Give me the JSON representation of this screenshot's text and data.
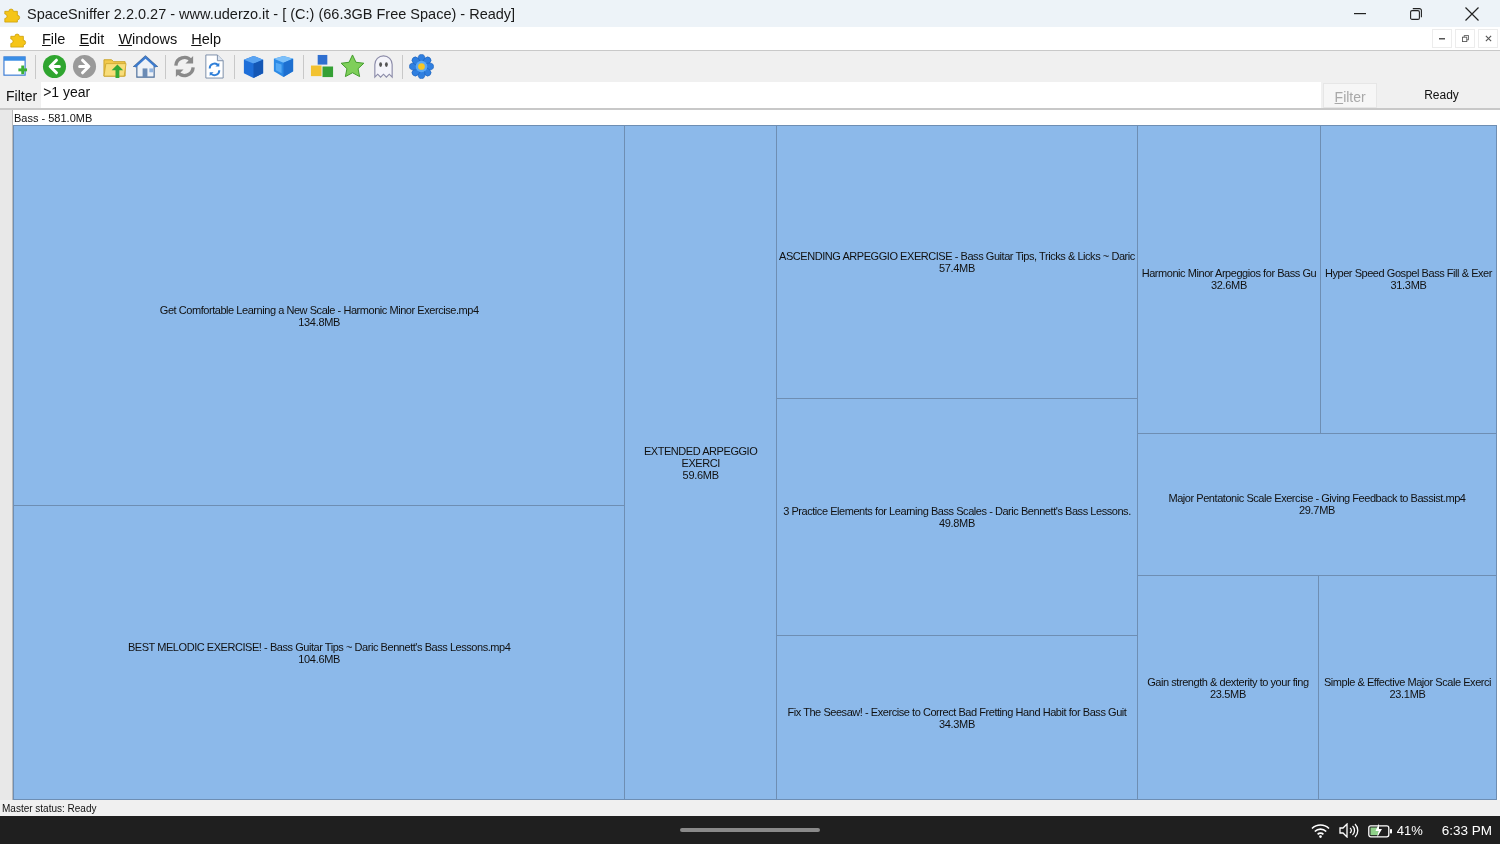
{
  "window": {
    "title": "SpaceSniffer 2.2.0.27 - www.uderzo.it - [ (C:) (66.3GB Free Space) - Ready]"
  },
  "menu": [
    "File",
    "Edit",
    "Windows",
    "Help"
  ],
  "toolbar": {
    "back_disabled": false,
    "forward_disabled": true
  },
  "filter": {
    "label": "Filter",
    "value": ">1 year",
    "button": {
      "label": "Filter",
      "disabled": true
    },
    "status": "Ready"
  },
  "treemap": {
    "header": "Bass - 581.0MB",
    "columns": [
      {
        "rows": [
          {
            "tiles": [
              {
                "name": "Get Comfortable Learning a New Scale - Harmonic Minor Exercise.mp4",
                "size": "134.8MB"
              }
            ]
          },
          {
            "tiles": [
              {
                "name": "BEST MELODIC EXERCISE! - Bass Guitar Tips ~ Daric Bennett's Bass Lessons.mp4",
                "size": "104.6MB"
              }
            ]
          }
        ]
      },
      {
        "rows": [
          {
            "tiles": [
              {
                "name": "EXTENDED ARPEGGIO EXERCI",
                "size": "59.6MB"
              }
            ]
          }
        ]
      },
      {
        "rows": [
          {
            "tiles": [
              {
                "name": "ASCENDING ARPEGGIO EXERCISE - Bass Guitar Tips, Tricks & Licks ~ Daric",
                "size": "57.4MB"
              }
            ]
          },
          {
            "tiles": [
              {
                "name": "3 Practice Elements for Learning Bass Scales - Daric Bennett's Bass Lessons.",
                "size": "49.8MB"
              }
            ]
          },
          {
            "tiles": [
              {
                "name": "Fix The Seesaw! - Exercise to Correct Bad Fretting Hand Habit for Bass Guit",
                "size": "34.3MB"
              }
            ]
          }
        ]
      },
      {
        "rows": [
          {
            "tiles": [
              {
                "name": "Harmonic Minor Arpeggios for Bass Gu",
                "size": "32.6MB"
              },
              {
                "name": "Hyper Speed Gospel Bass Fill & Exer",
                "size": "31.3MB"
              }
            ]
          },
          {
            "tiles": [
              {
                "name": "Major Pentatonic Scale Exercise - Giving Feedback to Bassist.mp4",
                "size": "29.7MB"
              }
            ]
          },
          {
            "tiles": [
              {
                "name": "Gain strength & dexterity to your fing",
                "size": "23.5MB"
              },
              {
                "name": "Simple & Effective Major Scale Exerci",
                "size": "23.1MB"
              }
            ]
          }
        ]
      }
    ]
  },
  "status_bar": {
    "text": "Master status: Ready"
  },
  "taskbar": {
    "battery": "41%",
    "time": "6:33 PM"
  }
}
